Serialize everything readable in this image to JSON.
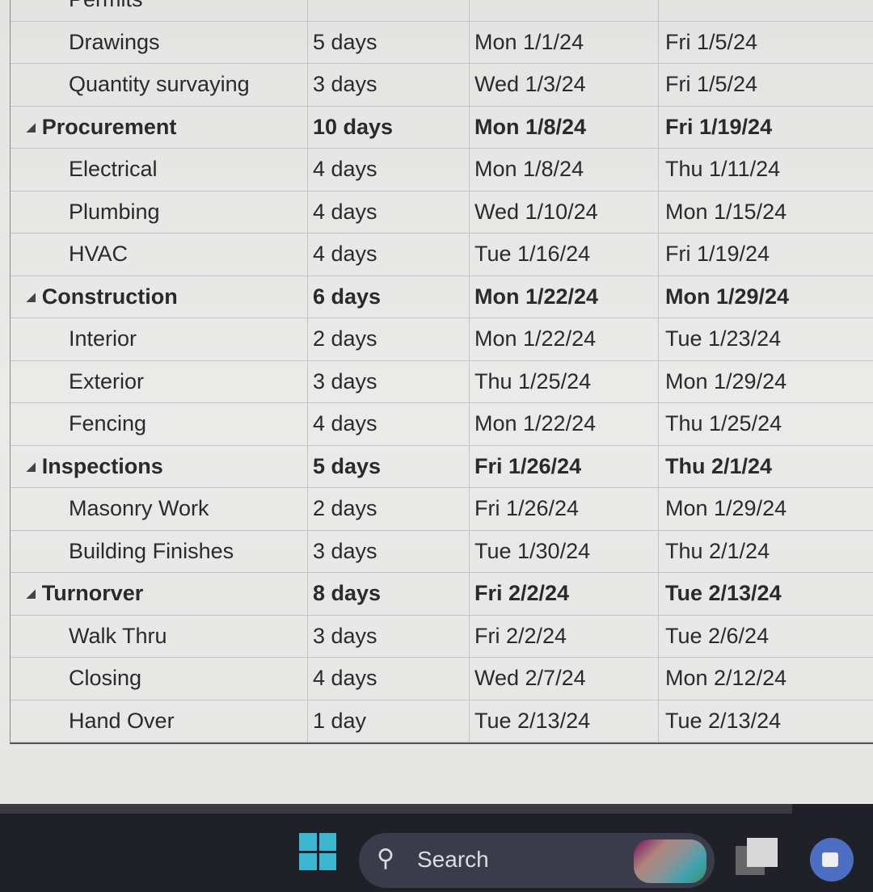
{
  "tasks": [
    {
      "name": "Permits",
      "duration": "",
      "start": "",
      "finish": "",
      "summary": false
    },
    {
      "name": "Drawings",
      "duration": "5 days",
      "start": "Mon 1/1/24",
      "finish": "Fri 1/5/24",
      "summary": false
    },
    {
      "name": "Quantity survaying",
      "duration": "3 days",
      "start": "Wed 1/3/24",
      "finish": "Fri 1/5/24",
      "summary": false
    },
    {
      "name": "Procurement",
      "duration": "10 days",
      "start": "Mon 1/8/24",
      "finish": "Fri 1/19/24",
      "summary": true
    },
    {
      "name": "Electrical",
      "duration": "4 days",
      "start": "Mon 1/8/24",
      "finish": "Thu 1/11/24",
      "summary": false
    },
    {
      "name": "Plumbing",
      "duration": "4 days",
      "start": "Wed 1/10/24",
      "finish": "Mon 1/15/24",
      "summary": false
    },
    {
      "name": "HVAC",
      "duration": "4 days",
      "start": "Tue 1/16/24",
      "finish": "Fri 1/19/24",
      "summary": false
    },
    {
      "name": "Construction",
      "duration": "6 days",
      "start": "Mon 1/22/24",
      "finish": "Mon 1/29/24",
      "summary": true
    },
    {
      "name": "Interior",
      "duration": "2 days",
      "start": "Mon 1/22/24",
      "finish": "Tue 1/23/24",
      "summary": false
    },
    {
      "name": "Exterior",
      "duration": "3 days",
      "start": "Thu 1/25/24",
      "finish": "Mon 1/29/24",
      "summary": false
    },
    {
      "name": "Fencing",
      "duration": "4 days",
      "start": "Mon 1/22/24",
      "finish": "Thu 1/25/24",
      "summary": false
    },
    {
      "name": "Inspections",
      "duration": "5 days",
      "start": "Fri 1/26/24",
      "finish": "Thu 2/1/24",
      "summary": true
    },
    {
      "name": "Masonry Work",
      "duration": "2 days",
      "start": "Fri 1/26/24",
      "finish": "Mon 1/29/24",
      "summary": false
    },
    {
      "name": "Building Finishes",
      "duration": "3 days",
      "start": "Tue 1/30/24",
      "finish": "Thu 2/1/24",
      "summary": false
    },
    {
      "name": "Turnorver",
      "duration": "8 days",
      "start": "Fri 2/2/24",
      "finish": "Tue 2/13/24",
      "summary": true
    },
    {
      "name": "Walk Thru",
      "duration": "3 days",
      "start": "Fri 2/2/24",
      "finish": "Tue 2/6/24",
      "summary": false
    },
    {
      "name": "Closing",
      "duration": "4 days",
      "start": "Wed 2/7/24",
      "finish": "Mon 2/12/24",
      "summary": false
    },
    {
      "name": "Hand Over",
      "duration": "1 day",
      "start": "Tue 2/13/24",
      "finish": "Tue 2/13/24",
      "summary": false
    }
  ],
  "taskbar": {
    "search_label": "Search",
    "start_icon": "windows-logo-icon",
    "search_icon": "magnifier-icon"
  },
  "colors": {
    "taskbar": "#1f2028",
    "windows_accent": "#3bb7d2"
  }
}
